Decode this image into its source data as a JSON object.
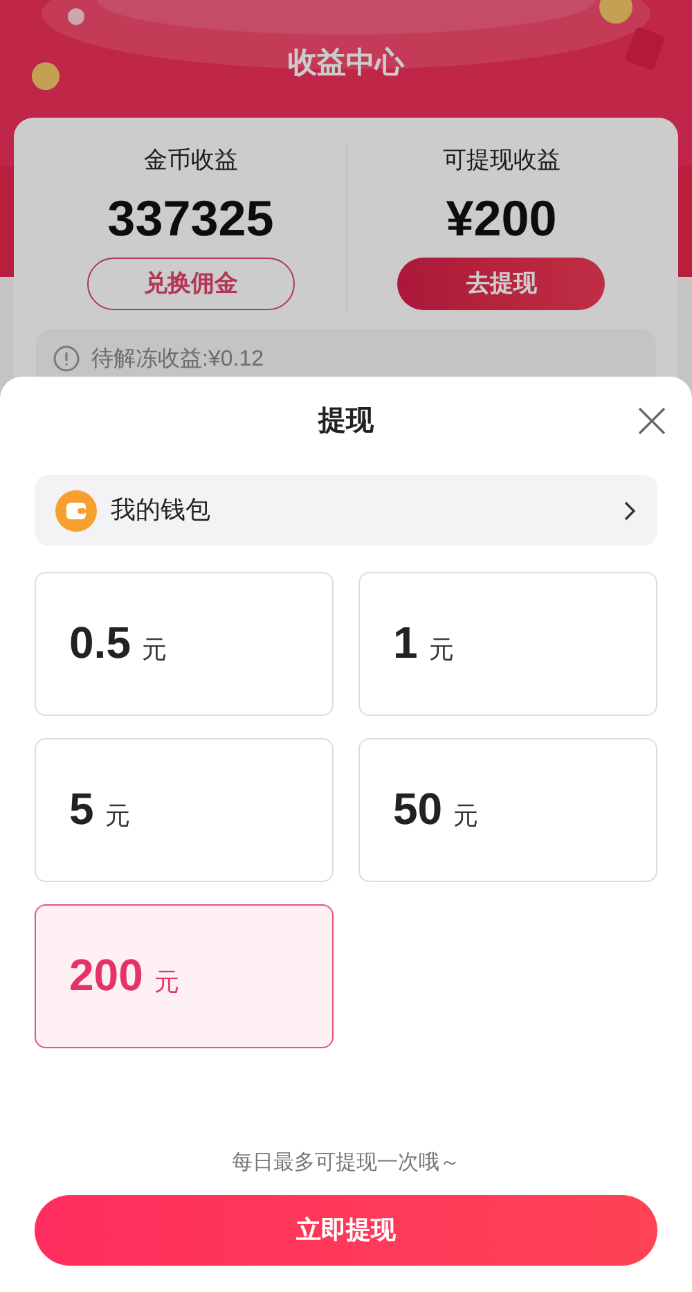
{
  "header": {
    "title": "收益中心"
  },
  "earnings": [
    {
      "label": "金币收益",
      "value": "337325",
      "action": {
        "label": "兑换佣金",
        "kind": "outline"
      }
    },
    {
      "label": "可提现收益",
      "value": "¥200",
      "action": {
        "label": "去提现",
        "kind": "filled"
      }
    }
  ],
  "pending": {
    "text": "待解冻收益:¥0.12"
  },
  "sheet": {
    "title": "提现",
    "wallet": {
      "label": "我的钱包"
    },
    "amounts": [
      {
        "value": "0.5",
        "unit": "元",
        "selected": false
      },
      {
        "value": "1",
        "unit": "元",
        "selected": false
      },
      {
        "value": "5",
        "unit": "元",
        "selected": false
      },
      {
        "value": "50",
        "unit": "元",
        "selected": false
      },
      {
        "value": "200",
        "unit": "元",
        "selected": true
      }
    ],
    "hint": "每日最多可提现一次哦～",
    "submit": "立即提现"
  }
}
